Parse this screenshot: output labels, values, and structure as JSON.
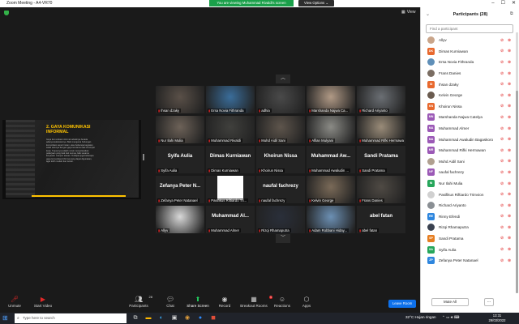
{
  "window": {
    "title": "Zoom Meeting - A4-VR70"
  },
  "banner": {
    "text": "You are viewing Muhammad Rivaldi's screen",
    "view_options": "View Options ⌄"
  },
  "view_label": "View",
  "slide": {
    "heading": "2. GAYA KOMUNIKASI INFORMAL",
    "body": "Gaya komunikasi informal sebaiknya berada adanya kelekatannya. Baik mengenai hubungan komunikasi seperti rekan, atau beberapa kegiatan, salah satunya dengan gaya terutama saat di tempat kerja. Tujuannya adalah untuk menyelesaikan pekerjaan yang baik dari semua, baik sesama karyawan maupun atasan. Terdapat juga beberapa gaya komunikasi informal yang dapat digunakan, agar lebih mudah dan lancar."
  },
  "tiles": [
    {
      "name": "Ihsan dzaky",
      "kind": "video",
      "color": "#5a5048"
    },
    {
      "name": "Ersa Novia Fithranda",
      "kind": "video",
      "color": "#3a6d9a"
    },
    {
      "name": "adhia",
      "kind": "video",
      "color": "#4a4a4a"
    },
    {
      "name": "Marshanda Najwa Ca...",
      "kind": "video",
      "color": "#b19a86"
    },
    {
      "name": "Richard Ariyanto",
      "kind": "video",
      "color": "#6b6f74"
    },
    {
      "name": "Nur Ilahi Mulia",
      "kind": "video",
      "color": "#6d6258"
    },
    {
      "name": "Muhammad Rivaldi",
      "kind": "video",
      "color": "#40403d"
    },
    {
      "name": "Muhd Aidil Sani",
      "kind": "video",
      "color": "#5e554c"
    },
    {
      "name": "Alfian Mulyani",
      "kind": "video",
      "color": "#8b8b86"
    },
    {
      "name": "Muhammad Rifki Hermawan",
      "kind": "video",
      "color": "#9a8c79"
    },
    {
      "name": "Syifa Aulia",
      "big": "Syifa Aulia",
      "kind": "name"
    },
    {
      "name": "Dimas Kurniawan",
      "big": "Dimas Kurniawan",
      "kind": "name"
    },
    {
      "name": "Khoirun Nissa",
      "big": "Khoirun Nissa",
      "kind": "name"
    },
    {
      "name": "Muhammad Awaludin ...",
      "big": "Muhammad Aw...",
      "kind": "name"
    },
    {
      "name": "Sandi Pratama",
      "big": "Sandi Pratama",
      "kind": "name"
    },
    {
      "name": "Zefanya Peter Natanael",
      "big": "Zefanya Peter N...",
      "kind": "name"
    },
    {
      "name": "Pasifikus Riftiardo Tri...",
      "kind": "white"
    },
    {
      "name": "naufal fachrezy",
      "big": "naufal fachrezy",
      "kind": "name"
    },
    {
      "name": "Kelvin George",
      "kind": "video",
      "color": "#7a6a58"
    },
    {
      "name": "Frans Danies",
      "kind": "video",
      "color": "#4f4a44"
    },
    {
      "name": "Allyv",
      "kind": "video",
      "color": "#d8d8d8"
    },
    {
      "name": "Muhammad Almer",
      "big": "Muhammad Al...",
      "kind": "name"
    },
    {
      "name": "Rizqi Rhamaputra",
      "kind": "video",
      "color": "#2a2f3a"
    },
    {
      "name": "Adam Robbani Hiday...",
      "kind": "video",
      "color": "#6c90b4"
    },
    {
      "name": "abel fatan",
      "big": "abel fatan",
      "kind": "name"
    }
  ],
  "toolbar": {
    "unmute": "Unmute",
    "start_video": "Start Video",
    "participants": "Participants",
    "participants_count": "28",
    "chat": "Chat",
    "share_screen": "Share Screen",
    "record": "Record",
    "breakout": "Breakout Rooms",
    "breakout_badge": "1",
    "reactions": "Reactions",
    "apps": "Apps",
    "leave": "Leave Room"
  },
  "panel": {
    "title": "Participants (28)",
    "search_placeholder": "Find a participant",
    "mute_all": "Mute All",
    "more": "...",
    "participants": [
      {
        "name": "Allyv",
        "initials": "",
        "color": "#c9a58a"
      },
      {
        "name": "Dimas Kurniawan",
        "initials": "DK",
        "color": "#e8692e"
      },
      {
        "name": "Ersa Novia Fithranda",
        "initials": "",
        "color": "#5f8fb8"
      },
      {
        "name": "Frans Danies",
        "initials": "",
        "color": "#7a6d62"
      },
      {
        "name": "Ihsan dzaky",
        "initials": "ID",
        "color": "#e8692e"
      },
      {
        "name": "Kelvin George",
        "initials": "",
        "color": "#6a5b4f"
      },
      {
        "name": "Khoirun Nissa",
        "initials": "KN",
        "color": "#e8692e"
      },
      {
        "name": "Marshanda Najwa Catelya",
        "initials": "MN",
        "color": "#9b59b6"
      },
      {
        "name": "Muhammad Almer",
        "initials": "MA",
        "color": "#9b59b6"
      },
      {
        "name": "Muhammad Awaludin Bagaskoro",
        "initials": "MA",
        "color": "#9b59b6"
      },
      {
        "name": "Muhammad Rifki Hermawan",
        "initials": "MR",
        "color": "#9b59b6"
      },
      {
        "name": "Muhd Aidil Sani",
        "initials": "",
        "color": "#b0a090"
      },
      {
        "name": "naufal fachrezy",
        "initials": "NF",
        "color": "#9b59b6"
      },
      {
        "name": "Nur Ilahi Mulia",
        "initials": "NI",
        "color": "#26a65b"
      },
      {
        "name": "Pasifikus Riftiardo Trimvion",
        "initials": "",
        "color": "#d0d0d0"
      },
      {
        "name": "Richard Ariyanto",
        "initials": "",
        "color": "#8a8f94"
      },
      {
        "name": "Rinny Efendi",
        "initials": "RE",
        "color": "#2e86de"
      },
      {
        "name": "Rizqi Rhamaputra",
        "initials": "",
        "color": "#3a4150"
      },
      {
        "name": "Sandi Pratama",
        "initials": "SP",
        "color": "#e67e22"
      },
      {
        "name": "Syifa Aulia",
        "initials": "SA",
        "color": "#26a65b"
      },
      {
        "name": "Zefanya Peter Natanael",
        "initials": "ZP",
        "color": "#2e86de"
      }
    ]
  },
  "taskbar": {
    "search_placeholder": "Type here to search",
    "weather": "32°C Hujan ringan",
    "time": "13:31",
    "date": "29/03/2022"
  },
  "colors": {
    "accent": "#0e71eb",
    "banner": "#1aa04a",
    "mic_muted": "#e02828",
    "slide_title": "#ffc300"
  }
}
